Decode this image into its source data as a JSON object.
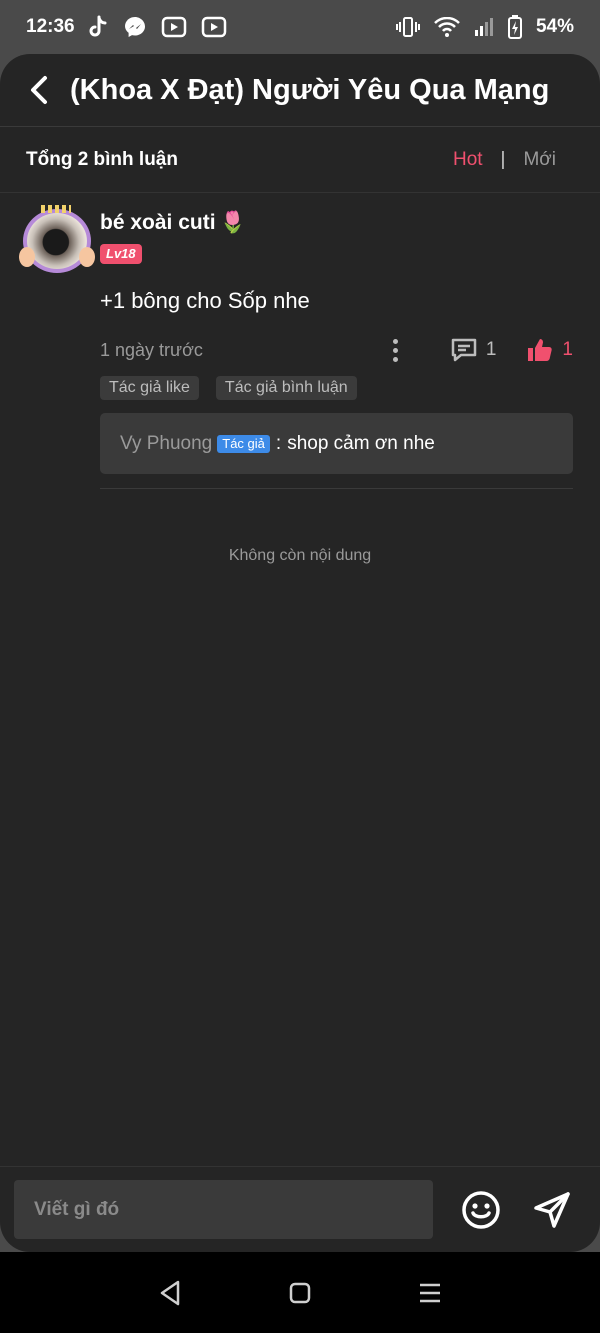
{
  "status_bar": {
    "time": "12:36",
    "battery": "54%",
    "left_icons": [
      "tiktok-icon",
      "messenger-icon",
      "youtube-icon",
      "youtube-icon"
    ],
    "right_icons": [
      "vibrate-icon",
      "wifi-icon",
      "signal-icon",
      "battery-icon"
    ]
  },
  "header": {
    "title": "(Khoa X Đạt) Người Yêu Qua Mạng"
  },
  "filter": {
    "total": "Tổng 2 bình luận",
    "hot": "Hot",
    "separator": "|",
    "new": "Mới"
  },
  "comment": {
    "username": "bé xoài cuti",
    "username_emoji": "🌷",
    "level": "Lv18",
    "content": "+1 bông cho Sốp nhe",
    "time": "1 ngày trước",
    "reply_count": "1",
    "like_count": "1",
    "tags": [
      "Tác giả like",
      "Tác giả bình luận"
    ],
    "reply": {
      "author": "Vy Phuong",
      "badge": "Tác giả",
      "separator": ":",
      "text": "shop cảm ơn nhe"
    }
  },
  "end_text": "Không còn nội dung",
  "composer": {
    "placeholder": "Viết gì đó"
  },
  "colors": {
    "accent": "#f0506e",
    "badge_blue": "#3d8be8",
    "background": "#252525",
    "panel": "#3a3a3a"
  }
}
